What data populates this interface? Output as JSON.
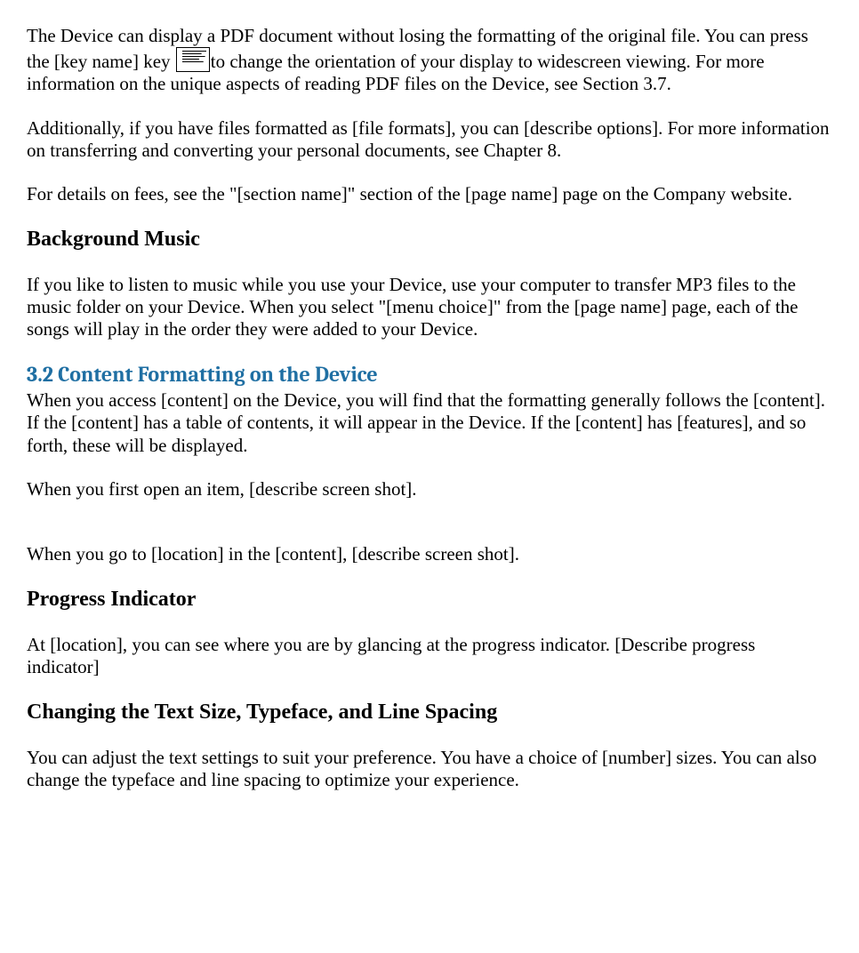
{
  "para_pdf_a": "The Device can display a PDF document without losing the formatting of the original file. You can press the [key name] key ",
  "para_pdf_b": "to change the orientation of your display to widescreen viewing. For more information on the unique aspects of reading PDF files on the Device, see Section 3.7.",
  "para_files": "Additionally, if you have files formatted as [file formats], you can [describe options]. For more information on transferring and converting your personal documents, see Chapter 8.",
  "para_fees": "For details on fees, see the \"[section name]\" section of the [page name] page on the Company website.",
  "h_music": "Background Music",
  "para_music": "If you like to listen to music while you use your Device, use your computer to transfer MP3 files to the music folder on your Device. When you select \"[menu choice]\" from the [page name] page, each of the songs will play in the order they were added to your Device.",
  "h_section32": "3.2 Content Formatting on the Device",
  "para_formatting": "When you access [content] on the Device, you will find that the formatting generally follows the [content]. If the [content] has a table of contents, it will appear in the Device. If the [content] has [features], and so forth, these will be displayed.",
  "para_firstopen": "When you first open an item, [describe screen shot].",
  "para_goto": "When you go to [location] in the [content], [describe screen shot].",
  "h_progress": "Progress Indicator",
  "para_progress": "At [location], you can see where you are by glancing at the progress indicator. [Describe progress indicator]",
  "h_textsize": "Changing the Text Size, Typeface, and Line Spacing",
  "para_textsize": "You can adjust the text settings to suit your preference. You have a choice of [number] sizes. You can also change the typeface and line spacing to optimize your experience."
}
